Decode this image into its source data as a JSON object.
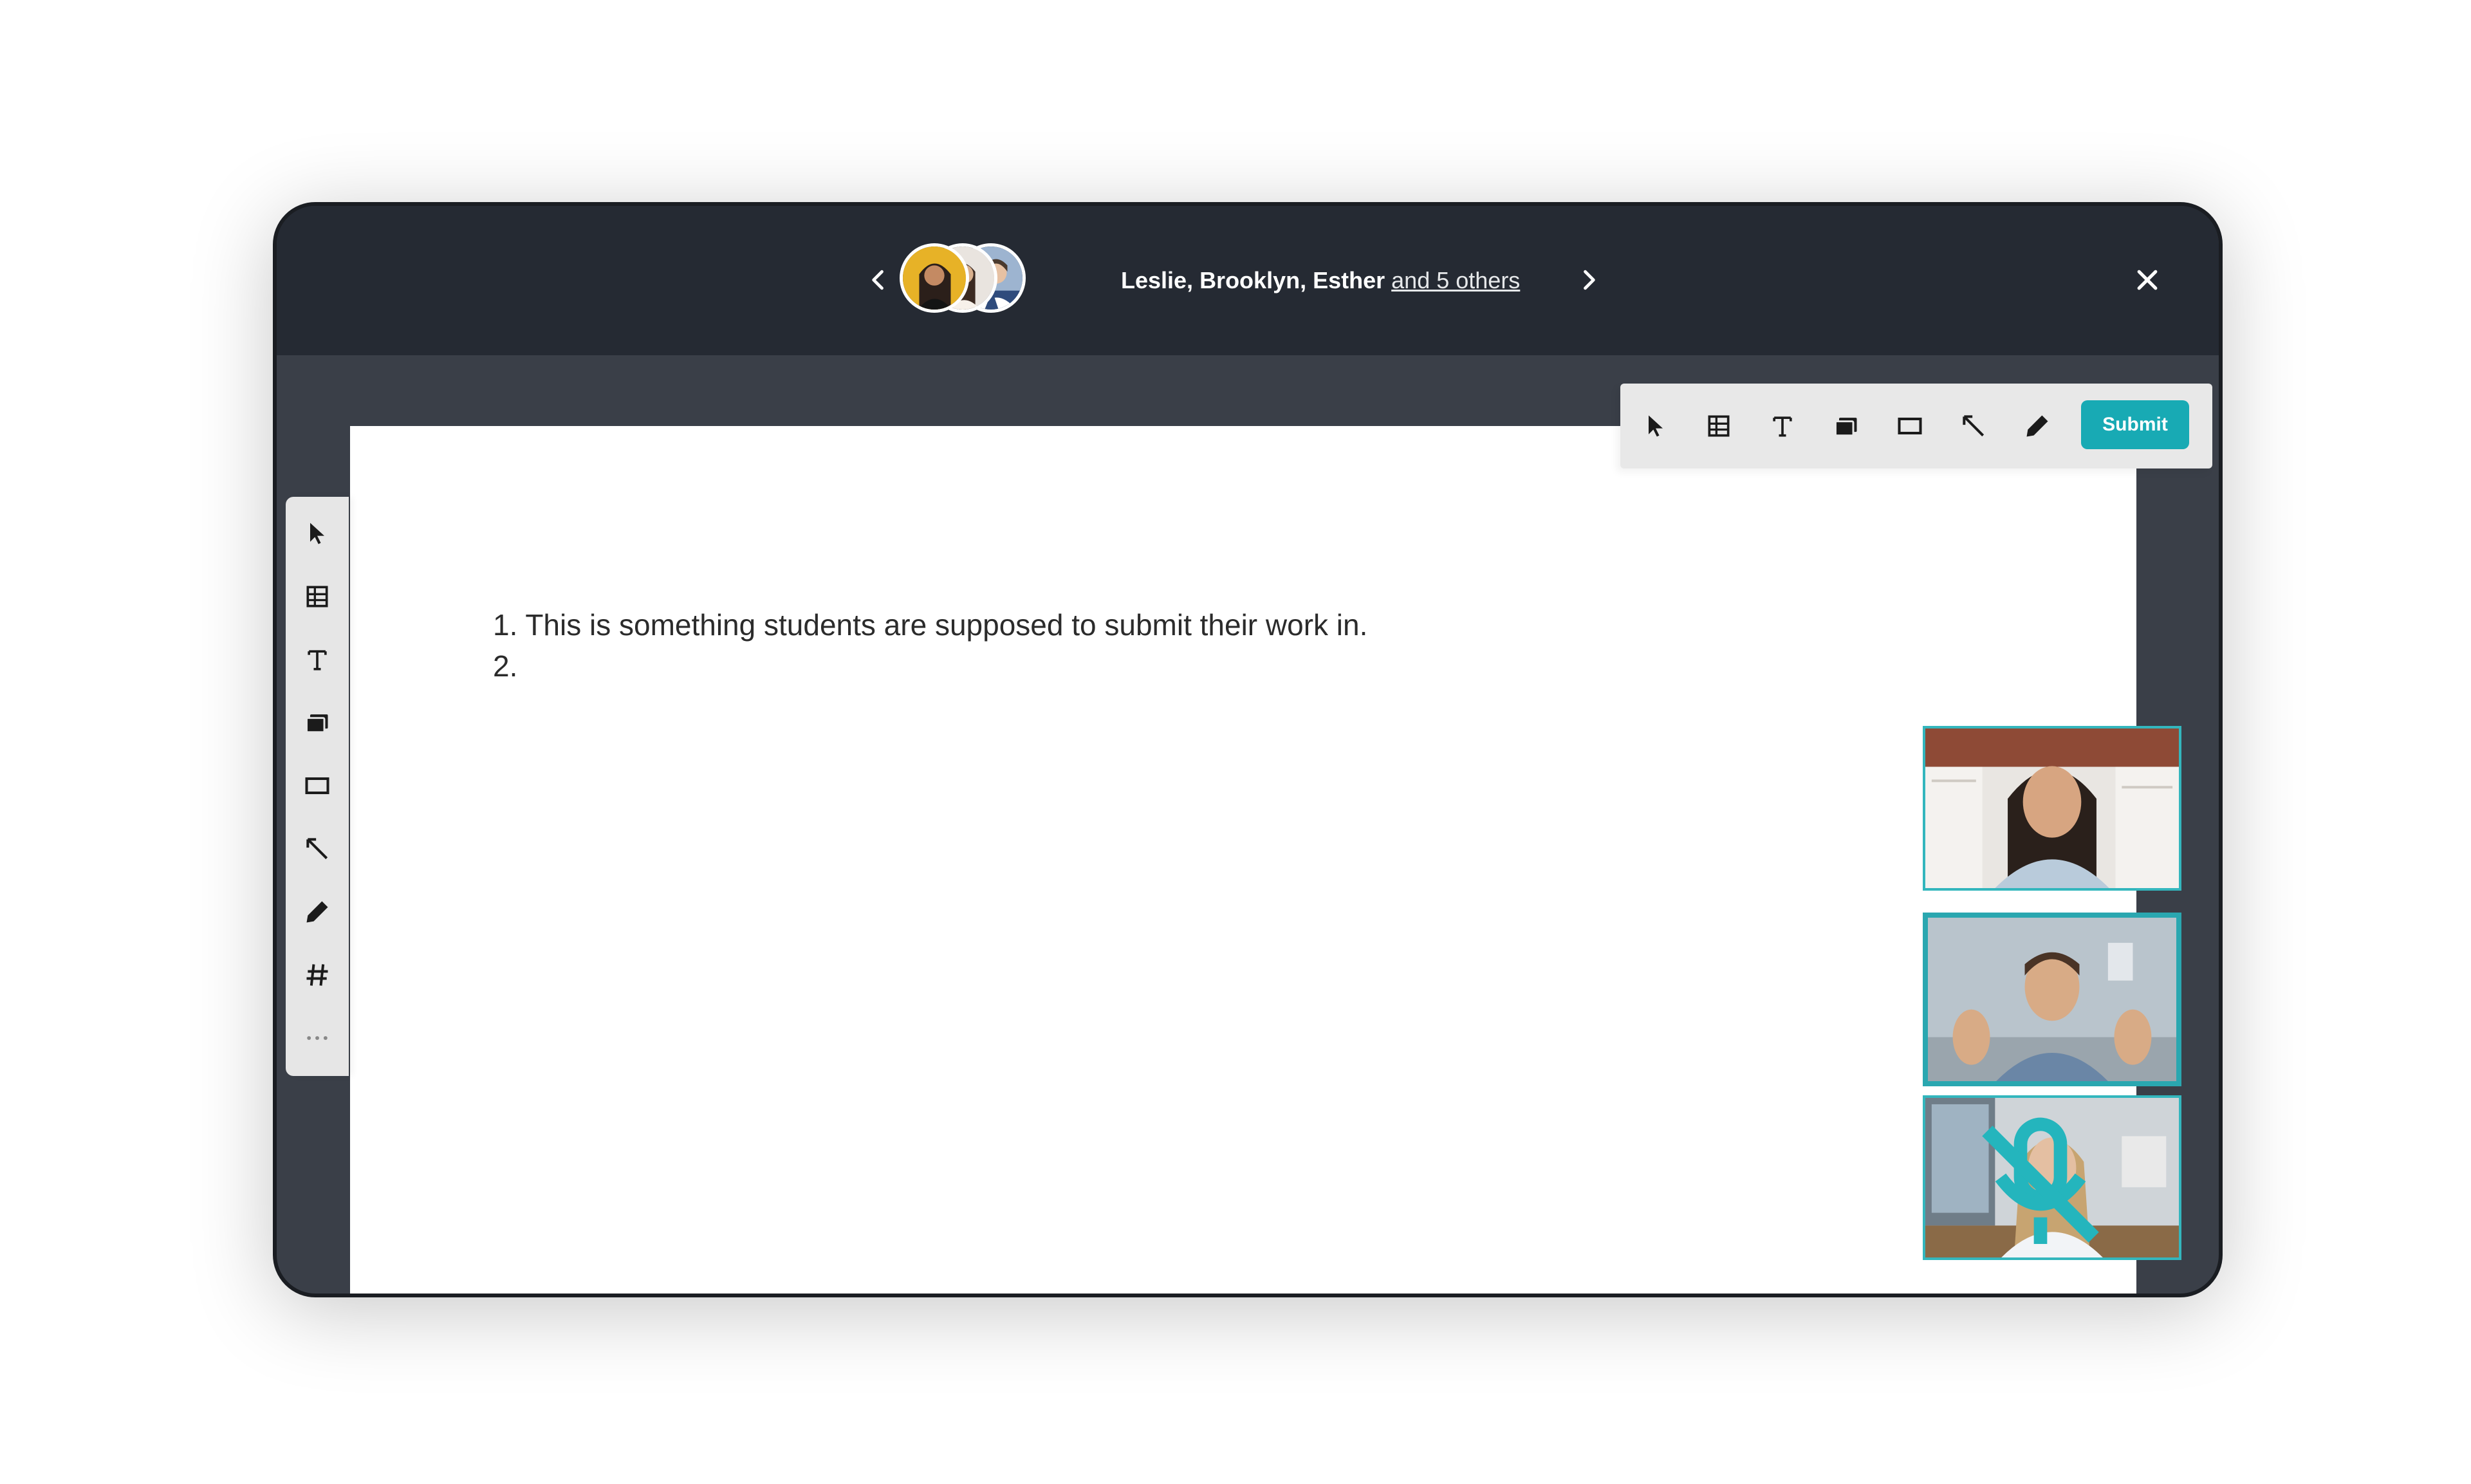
{
  "header": {
    "participants_names": "Leslie, Brooklyn, Esther",
    "participants_others": "and 5 others",
    "avatars": [
      "avatar-leslie",
      "avatar-brooklyn",
      "avatar-esther"
    ],
    "prev_icon": "chevron-left-icon",
    "next_icon": "chevron-right-icon",
    "close_icon": "close-icon"
  },
  "toolbar": {
    "submit_label": "Submit",
    "tools": [
      "cursor",
      "table",
      "text",
      "sticky-note",
      "rectangle",
      "line",
      "pen",
      "grid",
      "more"
    ]
  },
  "document": {
    "lines": [
      "1.  This is something students are supposed to submit their work in.",
      "2."
    ]
  },
  "videos": [
    {
      "name": "participant-video-1",
      "muted": false
    },
    {
      "name": "participant-video-2",
      "muted": false,
      "active": true
    },
    {
      "name": "participant-video-3",
      "muted": true
    }
  ],
  "colors": {
    "accent": "#18aab4",
    "header_bg": "#252a33",
    "workspace_bg": "#3a3f48"
  }
}
